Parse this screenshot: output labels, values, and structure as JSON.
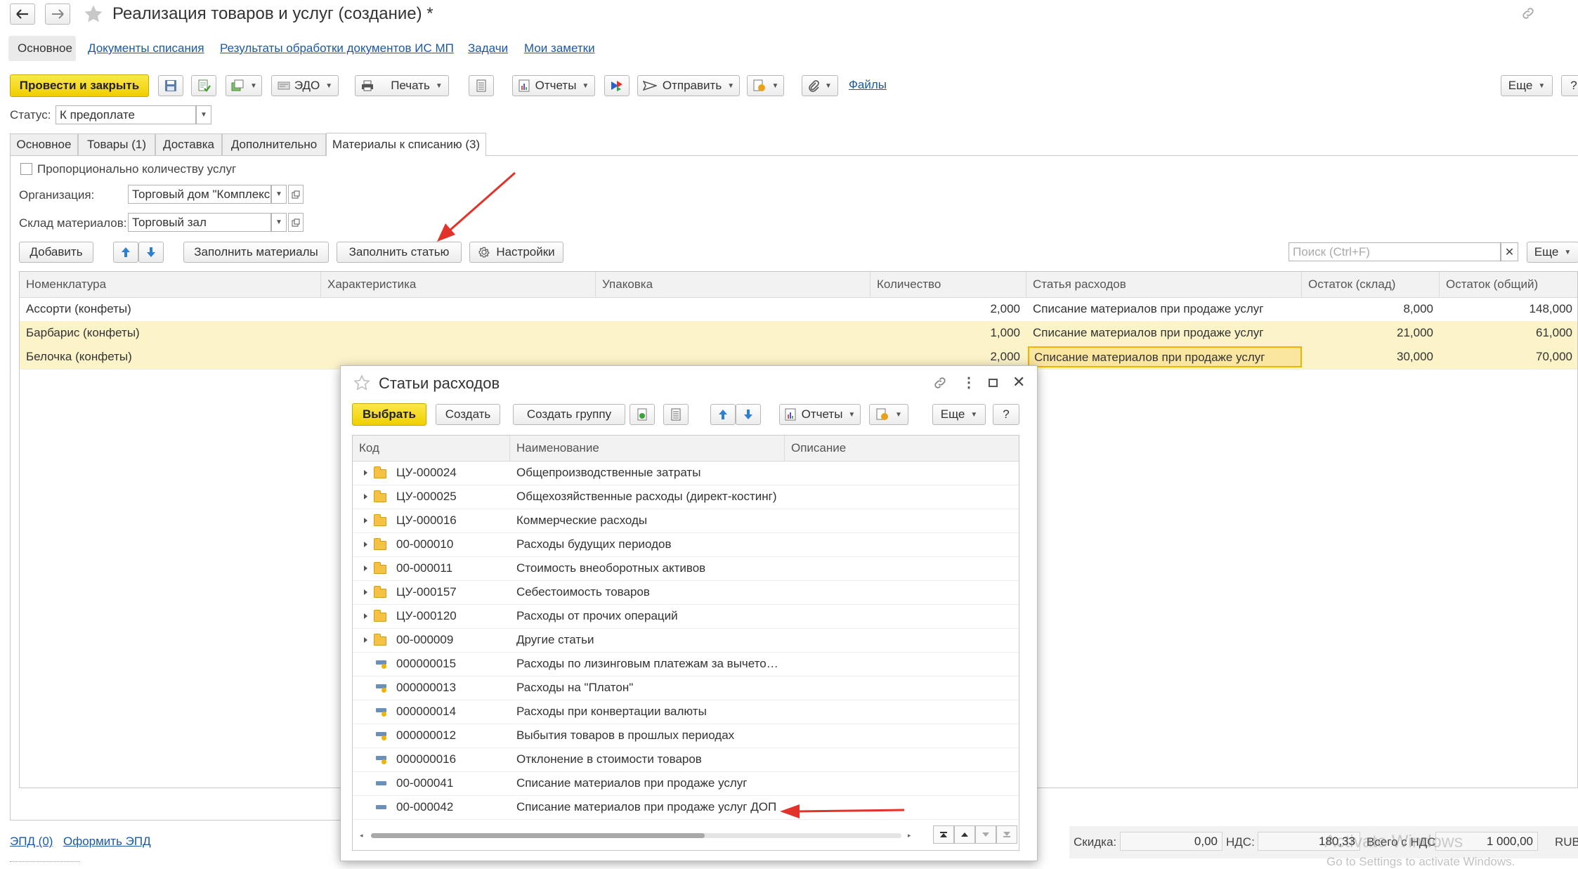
{
  "window": {
    "title": "Реализация товаров и услуг (создание) *"
  },
  "navlinks": [
    "Документы списания",
    "Результаты обработки документов ИС МП",
    "Задачи",
    "Мои заметки"
  ],
  "navactive": "Основное",
  "toolbar": {
    "post_close": "Провести и закрыть",
    "edo": "ЭДО",
    "print": "Печать",
    "reports": "Отчеты",
    "send": "Отправить",
    "files": "Файлы",
    "more": "Еще",
    "help": "?"
  },
  "status": {
    "label": "Статус:",
    "value": "К предоплате"
  },
  "tabs": [
    "Основное",
    "Товары (1)",
    "Доставка",
    "Дополнительно",
    "Материалы к списанию (3)"
  ],
  "materials": {
    "proportional_label": "Пропорционально количеству услуг",
    "org_label": "Организация:",
    "org_value": "Торговый дом \"Комплексный\"",
    "warehouse_label": "Склад материалов:",
    "warehouse_value": "Торговый зал",
    "add": "Добавить",
    "fill_materials": "Заполнить материалы",
    "fill_article": "Заполнить статью",
    "settings": "Настройки",
    "search_placeholder": "Поиск (Ctrl+F)",
    "more": "Еще",
    "columns": [
      "Номенклатура",
      "Характеристика",
      "Упаковка",
      "Количество",
      "Статья расходов",
      "Остаток (склад)",
      "Остаток (общий)"
    ],
    "rows": [
      {
        "name": "Ассорти (конфеты)",
        "char": "",
        "pack": "",
        "qty": "2,000",
        "article": "Списание материалов при продаже услуг",
        "stock": "8,000",
        "total": "148,000"
      },
      {
        "name": "Барбарис (конфеты)",
        "char": "",
        "pack": "",
        "qty": "1,000",
        "article": "Списание материалов при продаже услуг",
        "stock": "21,000",
        "total": "61,000"
      },
      {
        "name": "Белочка (конфеты)",
        "char": "",
        "pack": "",
        "qty": "2,000",
        "article": "Списание материалов при продаже услуг",
        "stock": "30,000",
        "total": "70,000"
      }
    ]
  },
  "footer": {
    "epd": "ЭПД (0)",
    "make_epd": "Оформить ЭПД",
    "discount_label": "Скидка:",
    "discount_value": "0,00",
    "vat_label": "НДС:",
    "vat_value": "180,33",
    "total_label": "Всего с НДС:",
    "total_value": "1 000,00",
    "currency": "RUB"
  },
  "watermark": {
    "line1": "Activate Windows",
    "line2": "Go to Settings to activate Windows."
  },
  "dialog": {
    "title": "Статьи расходов",
    "select": "Выбрать",
    "create": "Создать",
    "create_group": "Создать группу",
    "reports": "Отчеты",
    "more": "Еще",
    "help": "?",
    "columns": [
      "Код",
      "Наименование",
      "Описание"
    ],
    "rows": [
      {
        "type": "folder",
        "code": "ЦУ-000024",
        "name": "Общепроизводственные затраты"
      },
      {
        "type": "folder",
        "code": "ЦУ-000025",
        "name": "Общехозяйственные расходы (директ-костинг)"
      },
      {
        "type": "folder",
        "code": "ЦУ-000016",
        "name": "Коммерческие расходы"
      },
      {
        "type": "folder",
        "code": "00-000010",
        "name": "Расходы будущих периодов"
      },
      {
        "type": "folder",
        "code": "00-000011",
        "name": "Стоимость внеоборотных активов"
      },
      {
        "type": "folder",
        "code": "ЦУ-000157",
        "name": "Себестоимость товаров"
      },
      {
        "type": "folder",
        "code": "ЦУ-000120",
        "name": "Расходы от прочих операций"
      },
      {
        "type": "folder",
        "code": "00-000009",
        "name": "Другие статьи"
      },
      {
        "type": "predef",
        "code": "000000015",
        "name": "Расходы по лизинговым платежам за вычетом НДС"
      },
      {
        "type": "predef",
        "code": "000000013",
        "name": "Расходы на \"Платон\""
      },
      {
        "type": "predef",
        "code": "000000014",
        "name": "Расходы при конвертации валюты"
      },
      {
        "type": "predef",
        "code": "000000012",
        "name": "Выбытия товаров в прошлых периодах"
      },
      {
        "type": "predef",
        "code": "000000016",
        "name": "Отклонение в стоимости товаров"
      },
      {
        "type": "item",
        "code": "00-000041",
        "name": "Списание материалов при продаже услуг"
      },
      {
        "type": "item",
        "code": "00-000042",
        "name": "Списание материалов при продаже услуг ДОП"
      }
    ]
  }
}
